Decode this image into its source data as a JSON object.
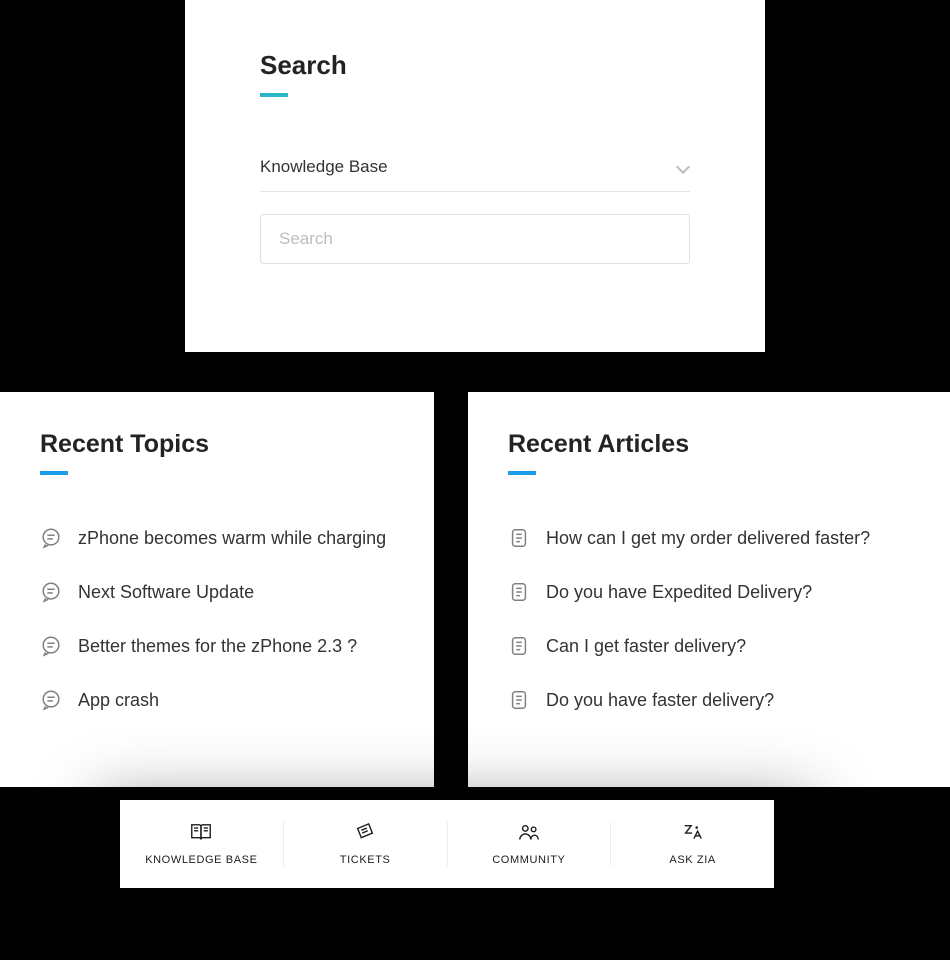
{
  "search": {
    "title": "Search",
    "scope_value": "Knowledge Base",
    "placeholder": "Search"
  },
  "recent_topics": {
    "title": "Recent Topics",
    "items": [
      "zPhone becomes warm while charging",
      "Next Software Update",
      "Better themes for the zPhone 2.3 ?",
      "App crash"
    ]
  },
  "recent_articles": {
    "title": "Recent Articles",
    "items": [
      "How can I get my order delivered faster?",
      "Do you have Expedited Delivery?",
      "Can I get faster delivery?",
      "Do you have faster delivery?"
    ]
  },
  "nav": {
    "items": [
      {
        "label": "KNOWLEDGE BASE",
        "icon": "book"
      },
      {
        "label": "TICKETS",
        "icon": "ticket"
      },
      {
        "label": "COMMUNITY",
        "icon": "community"
      },
      {
        "label": "ASK ZIA",
        "icon": "zia"
      }
    ]
  }
}
